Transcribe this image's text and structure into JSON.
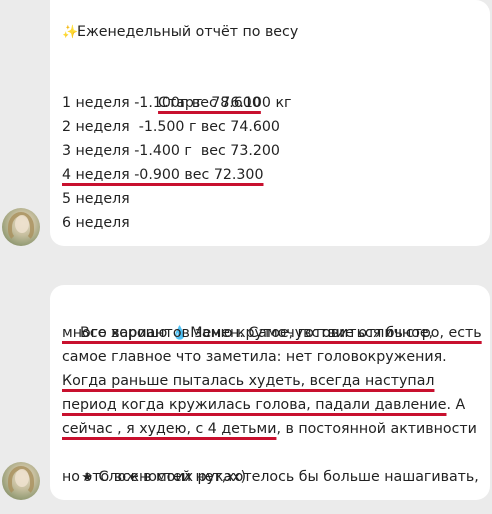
{
  "message1": {
    "title_icon": "sparkles-icon",
    "title": "Еженедельный отчёт по весу",
    "start_line": "Старт  78.600",
    "weeks": [
      "1 неделя -1.100г вес 76.100 кг",
      "2 неделя  -1.500 г вес 74.600",
      "3 неделя -1.400 г  вес 73.200",
      "4 неделя -0.900 вес 72.300",
      "5 неделя",
      "6 неделя"
    ]
  },
  "message2": {
    "l1_a": "Все хорошо ",
    "l1_icon": "drop-icon",
    "l1_b": " ",
    "l1_c": "Меню крутое, готовиться быстро, есть",
    "l2_a": "много вариантов замен",
    "l2_b": ". Самочувствие отличное,",
    "l3": "самое главное что заметила: нет головокружения.",
    "l4_a": "Когда раньше пыталась худеть, всегда наступал",
    "l5_a": "период когда кружилась голова, падали давление",
    "l5_b": ". А",
    "l6_a": "сейчас , я худею, с 4 детьми",
    "l6_b": ", в постоянной активности",
    "l7_icon": "star-icon",
    "l7": " Сложностей нет,хотелось бы больше нашагивать,",
    "l8": "но это все в моих руках)"
  },
  "colors": {
    "background": "#ebebeb",
    "bubble": "#ffffff",
    "underline": "#c8102e",
    "text": "#222222"
  }
}
